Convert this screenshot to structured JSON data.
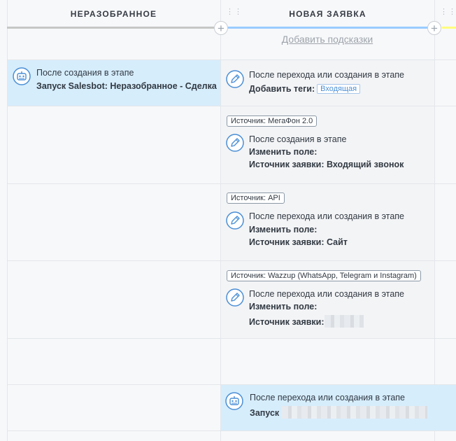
{
  "columns": [
    {
      "title": "НЕРАЗОБРАННОЕ",
      "bar_color": "#c6c6c6"
    },
    {
      "title": "НОВАЯ ЗАЯВКА",
      "bar_color": "#99ccff"
    },
    {
      "title": "",
      "bar_color": "#fffd7f"
    }
  ],
  "add_hints_label": "Добавить подсказки",
  "rows": {
    "r1_left": {
      "line1": "После создания в этапе",
      "line2": "Запуск Salesbot: Неразобранное - Сделка"
    },
    "r1_right": {
      "line1": "После перехода или создания в этапе",
      "line2": "Добавить теги:",
      "chip": "Входящая"
    },
    "r2_right": {
      "tag": "Источник: МегаФон 2.0",
      "line1": "После создания в этапе",
      "line2": "Изменить поле:",
      "line3": "Источник заявки: Входящий звонок"
    },
    "r3_right": {
      "tag": "Источник: API",
      "line1": "После перехода или создания в этапе",
      "line2": "Изменить поле:",
      "line3": "Источник заявки: Сайт"
    },
    "r4_right": {
      "tag": "Источник: Wazzup (WhatsApp, Telegram и Instagram)",
      "line1": "После перехода или создания в этапе",
      "line2": "Изменить поле:",
      "line3": "Источник заявки:"
    },
    "r6_right": {
      "line1": "После перехода или создания в этапе",
      "line2": "Запуск"
    }
  },
  "colors": {
    "highlight": "#d6edfc",
    "accent": "#4b8fd6"
  },
  "icons": [
    "robot-icon",
    "pencil-icon",
    "plus-icon",
    "drag-handle-icon"
  ]
}
